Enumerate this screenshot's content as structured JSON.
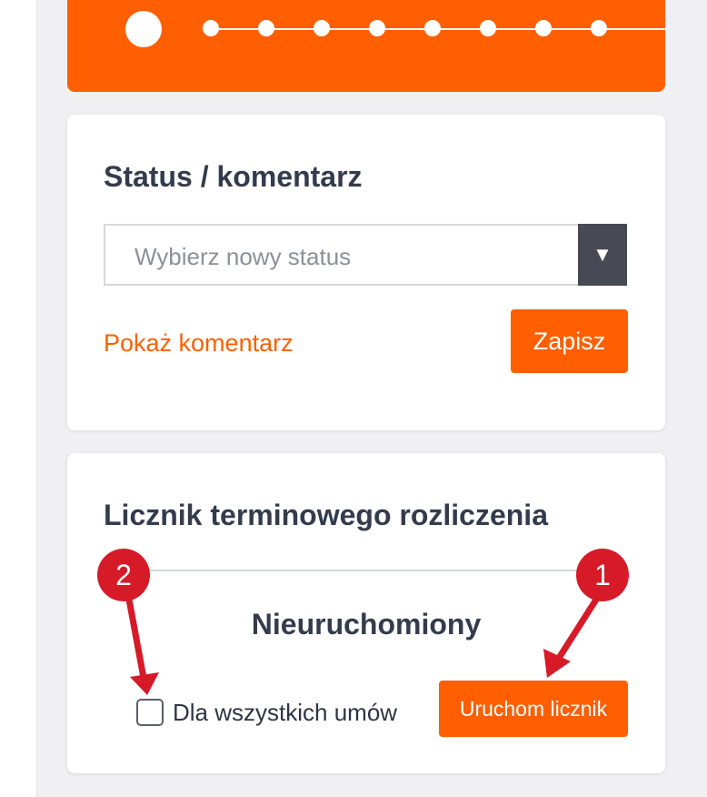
{
  "progress": {
    "step_count": 9,
    "current_step": 1,
    "accent_color": "#ff5f00"
  },
  "status_card": {
    "title": "Status / komentarz",
    "select": {
      "placeholder": "Wybierz nowy status",
      "toggle_icon": "▼"
    },
    "show_comment_link": "Pokaż komentarz",
    "save_button": "Zapisz"
  },
  "timer_card": {
    "title": "Licznik terminowego rozliczenia",
    "status_text": "Nieuruchomiony",
    "checkbox": {
      "label": "Dla wszystkich umów",
      "checked": false
    },
    "start_button": "Uruchom licznik"
  },
  "annotations": {
    "callout_1": "1",
    "callout_2": "2",
    "color": "#d61a28"
  }
}
